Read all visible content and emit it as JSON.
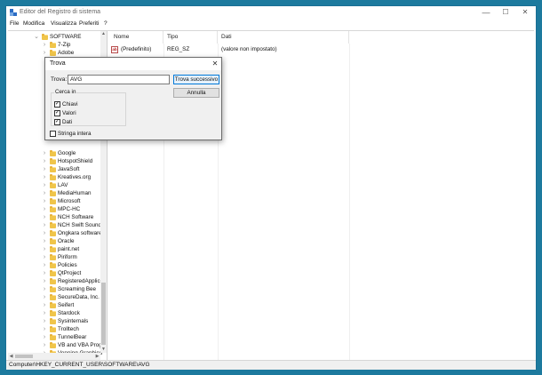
{
  "window": {
    "title": "Editor del Registro di sistema",
    "minimize": "—",
    "maximize": "☐",
    "close": "✕"
  },
  "menu": [
    "File",
    "Modifica",
    "Visualizza",
    "Preferiti",
    "?"
  ],
  "tree": {
    "root": "SOFTWARE",
    "items": [
      "7-Zip",
      "Adobe",
      "Google",
      "HotspotShield",
      "JavaSoft",
      "Kreatives.org",
      "LAV",
      "MediaHuman",
      "Microsoft",
      "MPC-HC",
      "NCH Software",
      "NCH Swift Sound",
      "Ongkara software",
      "Oracle",
      "paint.net",
      "Piriform",
      "Policies",
      "QtProject",
      "RegisteredApplica",
      "Screaming Bee",
      "SecureData, Inc.",
      "Seifert",
      "Stardock",
      "Sysinternals",
      "Trolltech",
      "TunnelBear",
      "VB and VBA Progr",
      "Venning Graphicu"
    ]
  },
  "list": {
    "columns": [
      "Nome",
      "Tipo",
      "Dati"
    ],
    "rows": [
      {
        "name": "(Predefinito)",
        "type": "REG_SZ",
        "data": "(valore non impostato)",
        "icon_text": "ab"
      }
    ]
  },
  "status": "Computer\\HKEY_CURRENT_USER\\SOFTWARE\\AVG",
  "dialog": {
    "title": "Trova",
    "close": "✕",
    "find_label": "Trova:",
    "find_value": "AVG",
    "find_next": "Trova successivo",
    "cancel": "Annulla",
    "group_label": "Cerca in",
    "options": [
      {
        "label": "Chiavi",
        "checked": true,
        "mark": "✓"
      },
      {
        "label": "Valori",
        "checked": true,
        "mark": "✓"
      },
      {
        "label": "Dati",
        "checked": true,
        "mark": "✓"
      }
    ],
    "whole_string": "Stringa intera"
  }
}
